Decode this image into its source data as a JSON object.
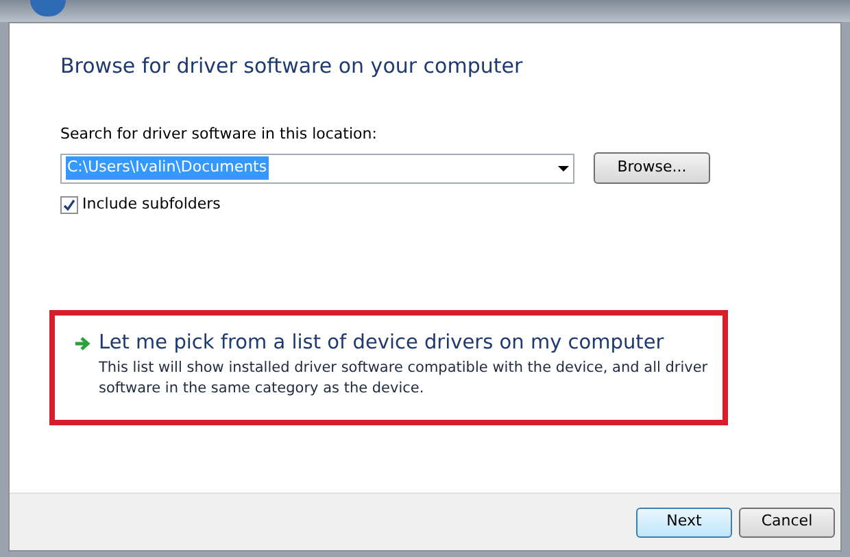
{
  "heading": "Browse for driver software on your computer",
  "search": {
    "label": "Search for driver software in this location:",
    "value": "C:\\Users\\Ivalin\\Documents",
    "browse": "Browse..."
  },
  "include_subfolders": {
    "label": "Include subfolders",
    "checked": true
  },
  "pick_option": {
    "title": "Let me pick from a list of device drivers on my computer",
    "description": "This list will show installed driver software compatible with the device, and all driver software in the same category as the device.",
    "highlighted": true
  },
  "buttons": [
    {
      "label": "Next",
      "default": true
    },
    {
      "label": "Cancel",
      "default": false
    }
  ]
}
